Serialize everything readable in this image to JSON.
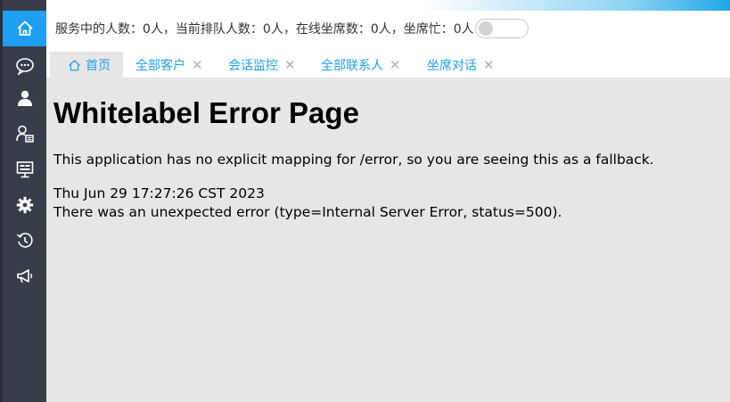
{
  "header": {
    "status_text": "服务中的人数：0人，当前排队人数：0人，在线坐席数：0人，坐席忙：0人"
  },
  "sidebar": {
    "items": [
      {
        "icon": "home-icon"
      },
      {
        "icon": "chat-icon"
      },
      {
        "icon": "user-icon"
      },
      {
        "icon": "contact-card-icon"
      },
      {
        "icon": "monitor-icon"
      },
      {
        "icon": "gear-icon"
      },
      {
        "icon": "history-icon"
      },
      {
        "icon": "megaphone-icon"
      }
    ]
  },
  "tabs": [
    {
      "label": "首页",
      "active": true
    },
    {
      "label": "全部客户",
      "close": "✕"
    },
    {
      "label": "会话监控",
      "close": "✕"
    },
    {
      "label": "全部联系人",
      "close": "✕"
    },
    {
      "label": "坐席对话",
      "close": "✕"
    }
  ],
  "error_page": {
    "title": "Whitelabel Error Page",
    "message": "This application has no explicit mapping for /error, so you are seeing this as a fallback.",
    "timestamp": "Thu Jun 29 17:27:26 CST 2023",
    "detail": "There was an unexpected error (type=Internal Server Error, status=500)."
  },
  "colors": {
    "accent": "#1e9ff2",
    "sidebar_bg": "#373d49",
    "content_bg": "#e6e6e6"
  }
}
